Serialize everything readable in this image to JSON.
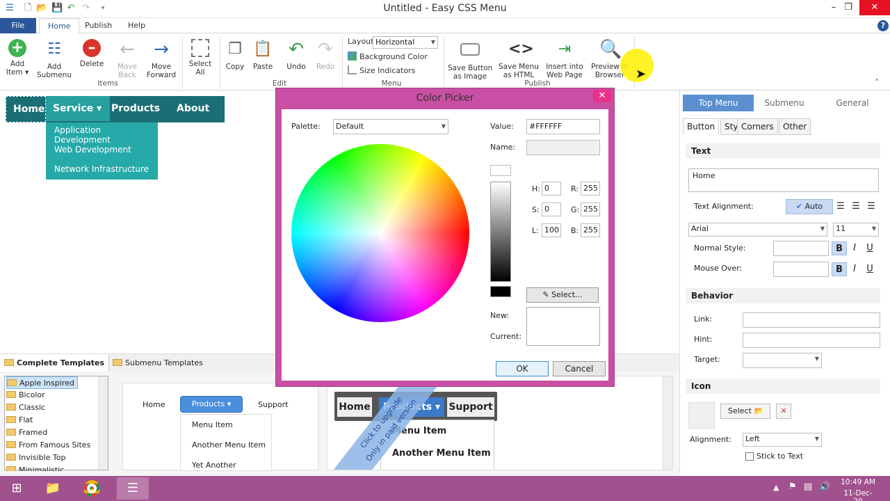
{
  "window": {
    "title": "Untitled - Easy CSS Menu"
  },
  "ribbon_tabs": [
    "File",
    "Home",
    "Publish",
    "Help"
  ],
  "ribbon": {
    "items_group": "Items",
    "edit_group": "Edit",
    "menu_group": "Menu",
    "publish_group": "Publish",
    "add_item": "Add\nItem ▾",
    "add_submenu": "Add\nSubmenu",
    "delete": "Delete",
    "move_back": "Move\nBack",
    "move_forward": "Move\nForward",
    "select_all": "Select\nAll",
    "copy": "Copy",
    "paste": "Paste",
    "undo": "Undo",
    "redo": "Redo",
    "layout_label": "Layout",
    "layout_value": "Horizontal",
    "background_color": "Background Color",
    "size_indicators": "Size Indicators",
    "save_image": "Save Button\nas Image",
    "save_html": "Save Menu\nas HTML",
    "insert_web": "Insert into\nWeb Page",
    "preview_browser": "Preview in\nBrowser"
  },
  "menu_preview": {
    "items": [
      "Home",
      "Service ▾",
      "Products ▾",
      "About Us"
    ],
    "submenu": [
      "Application Development",
      "Web Development",
      "Network Infrastructure"
    ]
  },
  "color_picker": {
    "title": "Color Picker",
    "palette_label": "Palette:",
    "palette_value": "Default",
    "value_label": "Value:",
    "value": "#FFFFFF",
    "name_label": "Name:",
    "h_label": "H:",
    "h": "0",
    "s_label": "S:",
    "s": "0",
    "l_label": "L:",
    "l": "100",
    "r_label": "R:",
    "r": "255",
    "g_label": "G:",
    "g": "255",
    "b_label": "B:",
    "b": "255",
    "select_btn": "Select...",
    "new_label": "New:",
    "current_label": "Current:",
    "ok": "OK",
    "cancel": "Cancel"
  },
  "right_panel": {
    "tabs": [
      "Top Menu",
      "Submenu",
      "General"
    ],
    "subtabs": [
      "Button",
      "Style",
      "Corners",
      "Other"
    ],
    "text_section": "Text",
    "text_value": "Home",
    "text_alignment": "Text Alignment:",
    "auto": "Auto",
    "font": "Arial",
    "font_size": "11",
    "normal_style": "Normal Style:",
    "mouse_over": "Mouse Over:",
    "bold": "B",
    "italic": "I",
    "underline": "U",
    "behavior_section": "Behavior",
    "link": "Link:",
    "hint": "Hint:",
    "target": "Target:",
    "icon_section": "Icon",
    "select": "Select",
    "alignment": "Alignment:",
    "alignment_value": "Left",
    "stick_to_text": "Stick to Text"
  },
  "templates": {
    "tabs": [
      "Complete Templates",
      "Submenu Templates"
    ],
    "list": [
      "Apple Inspired",
      "Bicolor",
      "Classic",
      "Flat",
      "Framed",
      "From Famous Sites",
      "Invisible Top",
      "Minimalistic"
    ],
    "preview1": {
      "items": [
        "Home",
        "Products ▾",
        "Support"
      ],
      "sub": [
        "Menu Item",
        "Another Menu Item",
        "Yet Another"
      ]
    },
    "preview2": {
      "items": [
        "Home",
        "Products ▾",
        "Support"
      ],
      "sub": [
        "Menu Item",
        "Another Menu Item"
      ],
      "ribbon": "Click to upgrade\nOnly in paid version"
    }
  },
  "taskbar": {
    "time": "10:49 AM",
    "date": "11-Dec-20"
  }
}
